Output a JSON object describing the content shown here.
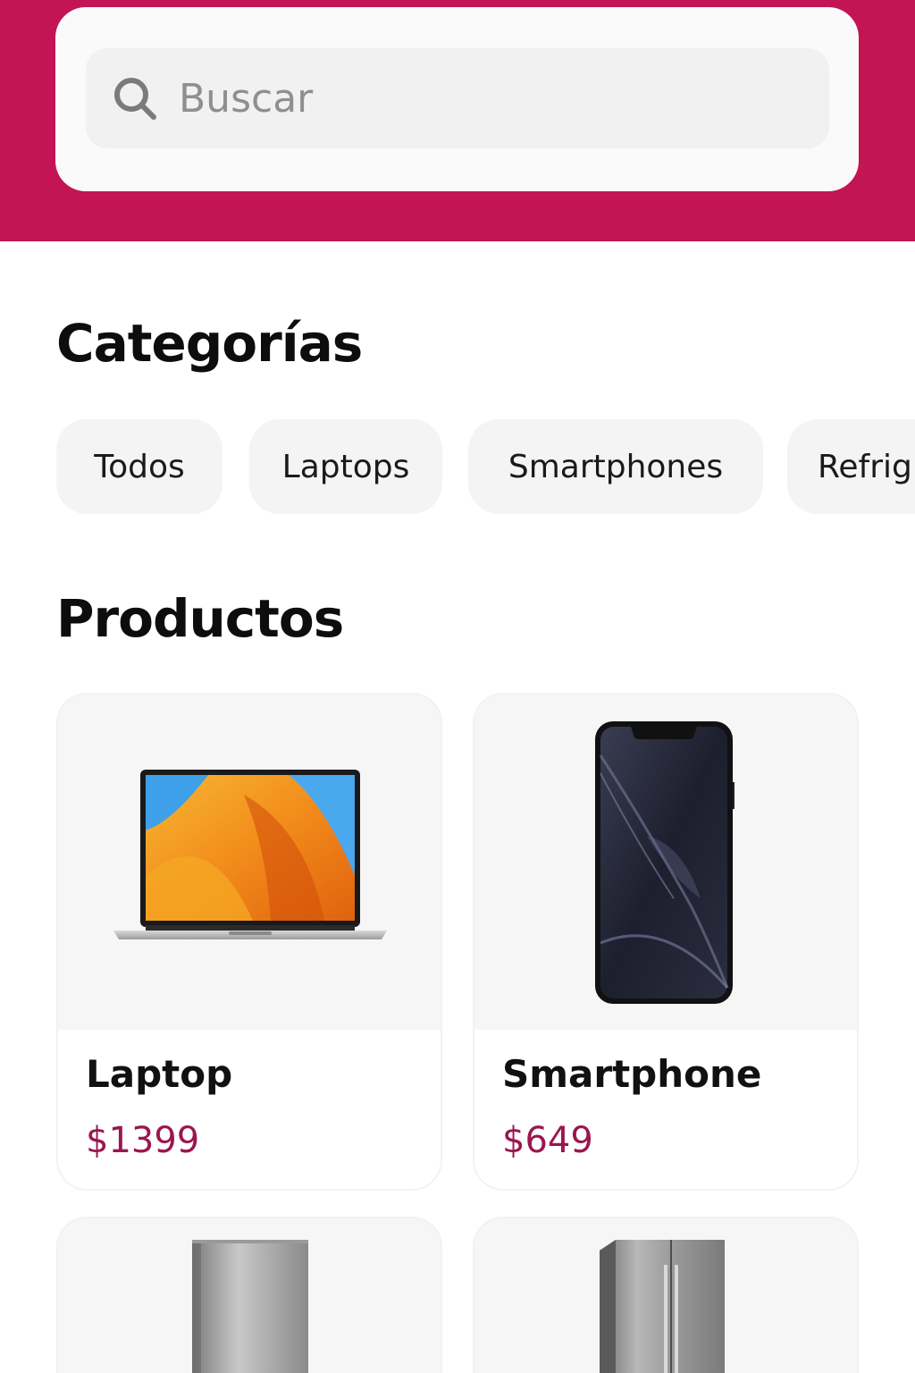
{
  "search": {
    "placeholder": "Buscar",
    "icon": "search-icon"
  },
  "sections": {
    "categories_title": "Categorías",
    "products_title": "Productos"
  },
  "categories": [
    {
      "label": "Todos"
    },
    {
      "label": "Laptops"
    },
    {
      "label": "Smartphones"
    },
    {
      "label": "Refrig"
    }
  ],
  "products": [
    {
      "name": "Laptop",
      "price": "$1399",
      "image": "laptop-image"
    },
    {
      "name": "Smartphone",
      "price": "$649",
      "image": "smartphone-image"
    },
    {
      "name": "",
      "price": "",
      "image": "refrigerator-image"
    },
    {
      "name": "",
      "price": "",
      "image": "side-by-side-refrigerator-image"
    }
  ],
  "colors": {
    "brand": "#c31454",
    "price": "#9b1650",
    "chip_bg": "#f4f4f4",
    "card_image_bg": "#f6f6f6"
  }
}
